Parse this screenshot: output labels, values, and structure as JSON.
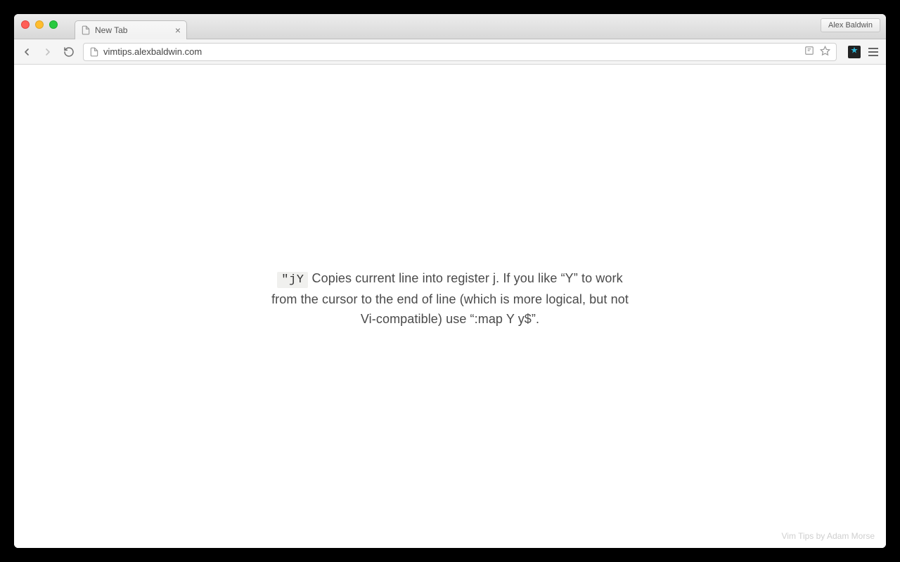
{
  "window": {
    "profile_name": "Alex Baldwin"
  },
  "tab": {
    "title": "New Tab"
  },
  "omnibox": {
    "url": "vimtips.alexbaldwin.com"
  },
  "tip": {
    "command": "\"jY",
    "description": "Copies current line into register j. If you like “Y” to work from the cursor to the end of line (which is more logical, but not Vi-compatible) use “:map Y y$”."
  },
  "footer": {
    "credit": "Vim Tips by Adam Morse"
  }
}
